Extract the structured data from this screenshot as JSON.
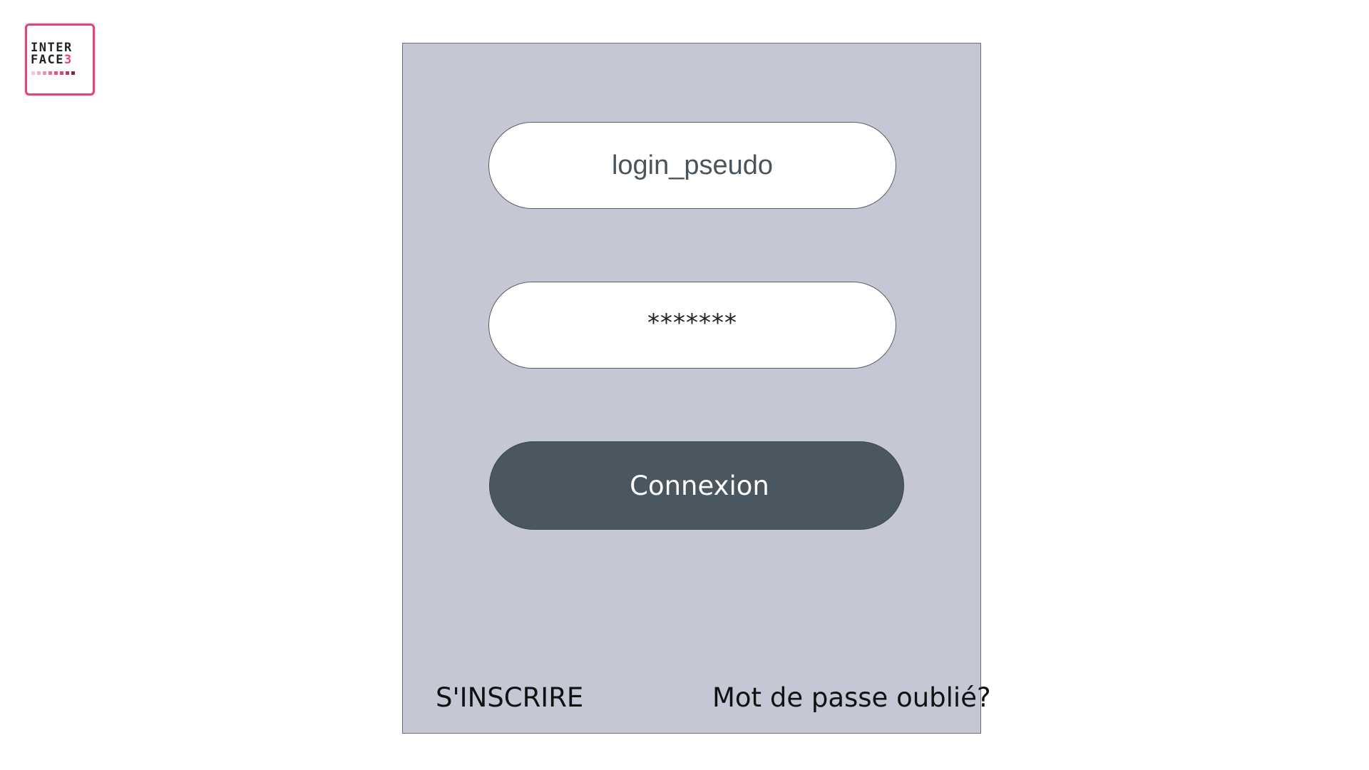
{
  "logo": {
    "line1": "INTER",
    "line2_main": "FACE",
    "line2_accent": "3",
    "brand_color": "#e0467e"
  },
  "login_form": {
    "username_value": "login_pseudo",
    "password_value": "*******",
    "submit_label": "Connexion",
    "signup_label": "S'INSCRIRE",
    "forgot_label": "Mot de passe oublié?"
  },
  "colors": {
    "panel_bg": "#c5c7d4",
    "button_bg": "#4a5660",
    "field_bg": "#ffffff"
  }
}
